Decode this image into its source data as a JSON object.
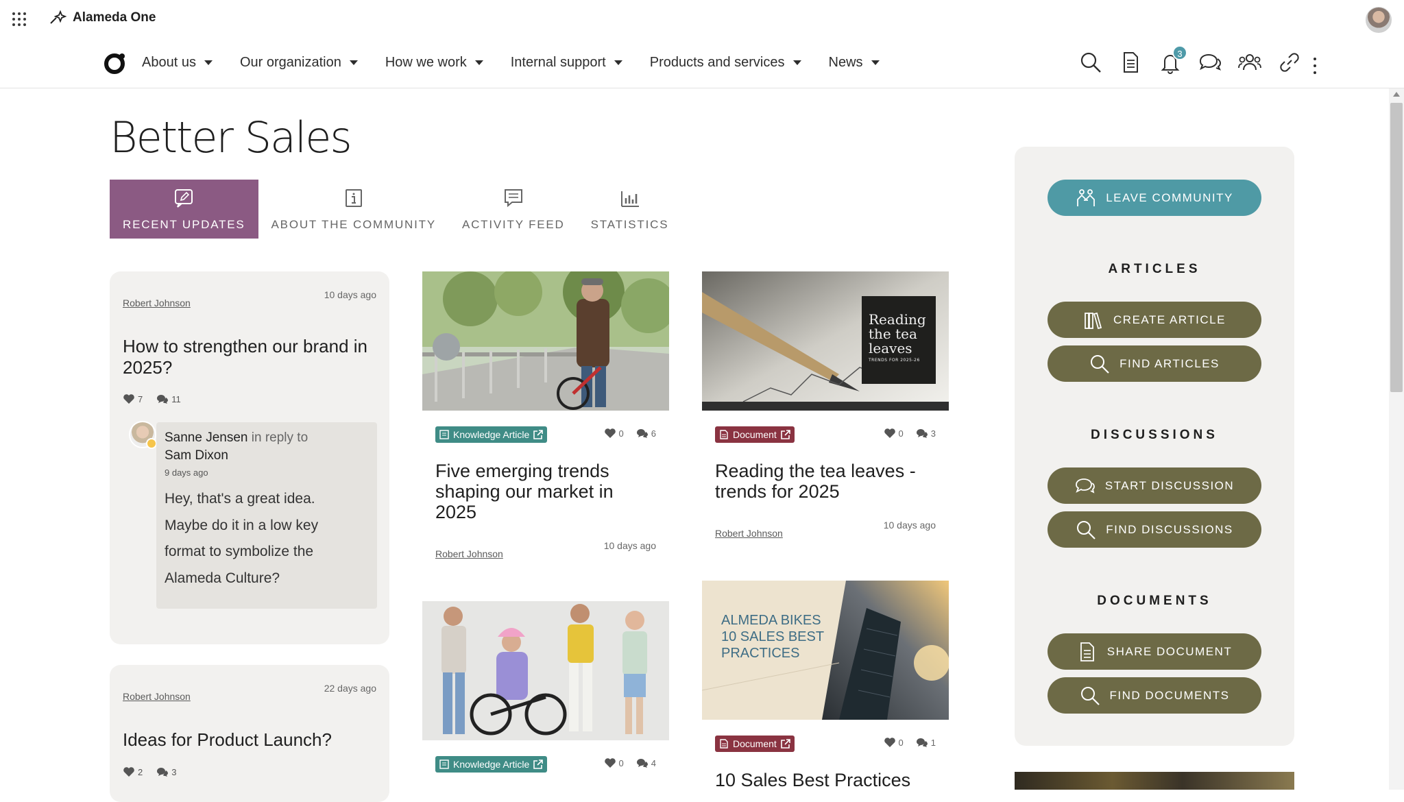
{
  "top": {
    "brand": "Alameda One"
  },
  "nav": {
    "items": [
      "About us",
      "Our organization",
      "How we work",
      "Internal support",
      "Products and services",
      "News"
    ],
    "notifications_count": "3"
  },
  "page": {
    "title": "Better Sales"
  },
  "tabs": [
    "RECENT UPDATES",
    "ABOUT THE COMMUNITY",
    "ACTIVITY FEED",
    "STATISTICS"
  ],
  "discussions": [
    {
      "author": "Robert Johnson",
      "time": "10 days ago",
      "title": "How to strengthen our brand in 2025?",
      "likes": "7",
      "comments": "11",
      "reply": {
        "name": "Sanne Jensen",
        "in_reply_to": "in reply to",
        "target": "Sam Dixon",
        "time": "9 days ago",
        "lines": [
          "Hey, that's a great idea.",
          "Maybe do it in a low key",
          "format to symbolize the",
          "Alameda Culture?"
        ]
      }
    },
    {
      "author": "Robert Johnson",
      "time": "22 days ago",
      "title": "Ideas for Product Launch?",
      "likes": "2",
      "comments": "3"
    }
  ],
  "cards": [
    {
      "tag": "Knowledge Article",
      "likes": "0",
      "comments": "6",
      "title": "Five emerging trends shaping our market in 2025",
      "author": "Robert Johnson",
      "time": "10 days ago"
    },
    {
      "tag": "Document",
      "likes": "0",
      "comments": "3",
      "title": "Reading the tea leaves - trends for 2025",
      "author": "Robert Johnson",
      "time": "10 days ago",
      "image_text": [
        "Reading",
        "the tea",
        "leaves",
        "TRENDS FOR 2025-26"
      ]
    },
    {
      "tag": "Knowledge Article",
      "likes": "0",
      "comments": "4"
    },
    {
      "tag": "Document",
      "likes": "0",
      "comments": "1",
      "title": "10 Sales Best Practices",
      "image_text": [
        "ALMEDA BIKES",
        "10 SALES BEST",
        "PRACTICES"
      ]
    }
  ],
  "sidebar": {
    "leave": "LEAVE COMMUNITY",
    "articles_heading": "ARTICLES",
    "create_article": "CREATE ARTICLE",
    "find_articles": "FIND ARTICLES",
    "discussions_heading": "DISCUSSIONS",
    "start_discussion": "START DISCUSSION",
    "find_discussions": "FIND DISCUSSIONS",
    "documents_heading": "DOCUMENTS",
    "share_document": "SHARE DOCUMENT",
    "find_documents": "FIND DOCUMENTS"
  },
  "colors": {
    "tab_active": "#8b5a83",
    "teal": "#4f9aa5",
    "olive": "#6d6a46",
    "knowledge_tag": "#3f8c86",
    "document_tag": "#8a3341"
  }
}
